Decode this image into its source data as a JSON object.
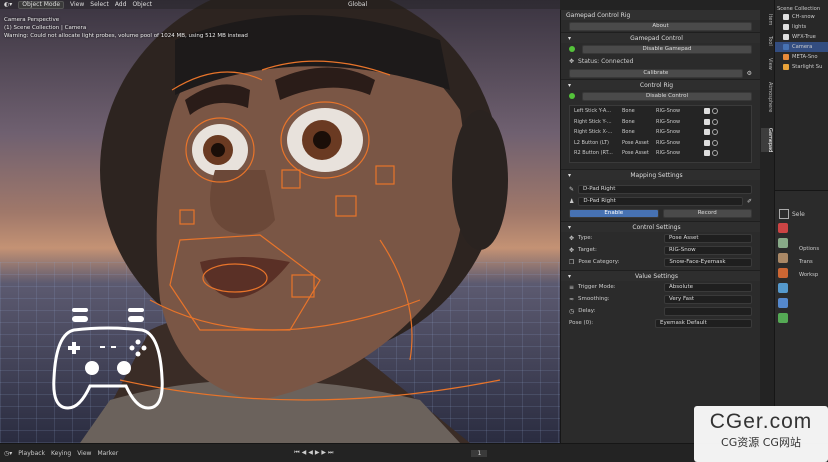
{
  "viewport": {
    "mode": "Object Mode",
    "menus": [
      "View",
      "Select",
      "Add",
      "Object"
    ],
    "transform": "Global",
    "overlay": [
      "Camera Perspective",
      "(1) Scene Collection | Camera",
      "Warning: Could not allocate light probes, volume pool of 1024 MB, using 512 MB instead"
    ]
  },
  "panel": {
    "title": "Gamepad Control Rig",
    "about": "About",
    "gamepad_control": "Gamepad Control",
    "disable_gamepad": "Disable Gamepad",
    "status": "Status: Connected",
    "calibrate": "Calibrate",
    "control_rig": "Control Rig",
    "disable_control": "Disable Control",
    "list": [
      {
        "input": "Left Stick Y-A...",
        "type": "Bone",
        "target": "RIG-Snow"
      },
      {
        "input": "Right Stick Y-...",
        "type": "Bone",
        "target": "RIG-Snow"
      },
      {
        "input": "Right Stick X-...",
        "type": "Bone",
        "target": "RIG-Snow"
      },
      {
        "input": "L2 Button (LT)",
        "type": "Pose Asset",
        "target": "RIG-Snow"
      },
      {
        "input": "R2 Button (RT...",
        "type": "Pose Asset",
        "target": "RIG-Snow"
      }
    ],
    "mapping_settings": "Mapping Settings",
    "mapping_name": "D-Pad Right",
    "mapping_button": "D-Pad Right",
    "enable": "Enable",
    "record": "Record",
    "control_settings": "Control Settings",
    "type_label": "Type:",
    "type_value": "Pose Asset",
    "target_label": "Target:",
    "target_value": "RIG-Snow",
    "pose_cat_label": "Pose Category:",
    "pose_cat_value": "Snow-Face-Eyemask",
    "value_settings": "Value Settings",
    "trigger_label": "Trigger Mode:",
    "trigger_value": "Absolute",
    "smoothing_label": "Smoothing:",
    "smoothing_value": "Very Fast",
    "delay_label": "Delay:",
    "pose_label": "Pose (0):",
    "pose_value": "Eyemask Default"
  },
  "tabs": [
    "Item",
    "Tool",
    "View",
    "Atmosphere",
    "Gamepad"
  ],
  "outliner": {
    "title": "Scene Collection",
    "items": [
      {
        "label": "CH-snow",
        "color": "#e0e0e0"
      },
      {
        "label": "lights",
        "color": "#e0e0e0"
      },
      {
        "label": "WFX-True",
        "color": "#e0e0e0"
      },
      {
        "label": "Camera",
        "color": "#4772b3"
      },
      {
        "label": "META-Sno",
        "color": "#e88a3a"
      },
      {
        "label": "Starlight Su",
        "color": "#e8a23a"
      }
    ]
  },
  "properties": {
    "tabs_label": "Sele",
    "options": "Options",
    "transform": "Trans",
    "workspace": "Worksp"
  },
  "footer": {
    "items": [
      "Playback",
      "Keying",
      "View",
      "Marker"
    ],
    "frame": "1"
  },
  "watermark": {
    "big": "CGer.com",
    "small": "CG资源 CG网站"
  }
}
